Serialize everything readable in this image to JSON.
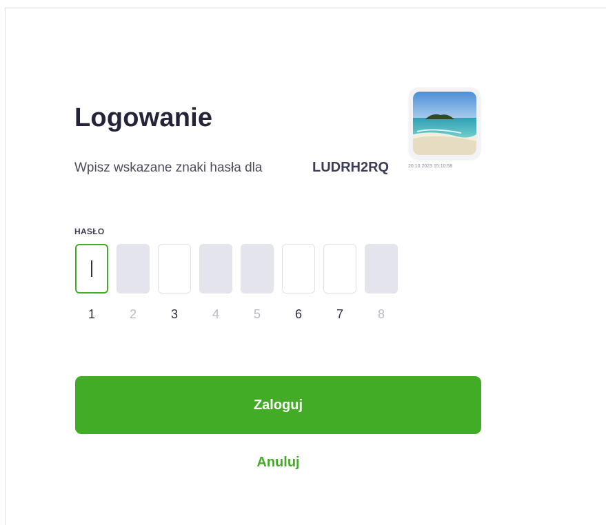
{
  "login": {
    "title": "Logowanie",
    "subtitle": "Wpisz wskazane znaki hasła dla",
    "username": "LUDRH2RQ",
    "security_image": {
      "description_icon": "beach-photo-icon",
      "timestamp": "20.10.2023 15:10:58"
    }
  },
  "password": {
    "label": "HASŁO",
    "characters": [
      {
        "number": "1",
        "state": "active"
      },
      {
        "number": "2",
        "state": "disabled"
      },
      {
        "number": "3",
        "state": "enabled"
      },
      {
        "number": "4",
        "state": "disabled"
      },
      {
        "number": "5",
        "state": "disabled"
      },
      {
        "number": "6",
        "state": "enabled"
      },
      {
        "number": "7",
        "state": "enabled"
      },
      {
        "number": "8",
        "state": "disabled"
      }
    ]
  },
  "actions": {
    "login_label": "Zaloguj",
    "cancel_label": "Anuluj"
  },
  "colors": {
    "accent": "#43ac26",
    "title": "#23243a",
    "disabled_box": "#e4e5ec"
  }
}
